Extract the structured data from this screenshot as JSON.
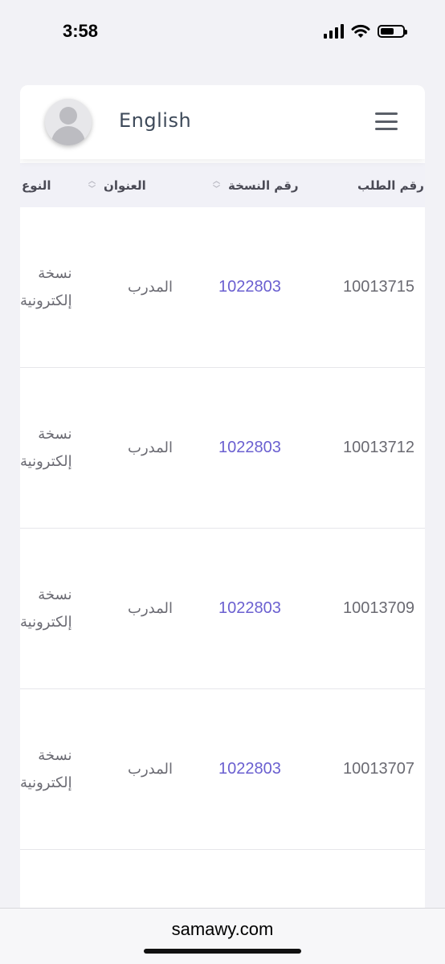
{
  "status_bar": {
    "time": "3:58"
  },
  "header": {
    "language_link": "English",
    "avatar_icon": "user-avatar-icon",
    "menu_icon": "hamburger-menu-icon"
  },
  "table": {
    "columns": {
      "order_number": "رقم الطلب",
      "copy_number": "رقم النسخة",
      "title": "العنوان",
      "type": "النوع"
    },
    "rows": [
      {
        "order_number": "10013715",
        "copy_number": "1022803",
        "title": "المدرب",
        "type_line1": "نسخة",
        "type_line2": "إلكترونية"
      },
      {
        "order_number": "10013712",
        "copy_number": "1022803",
        "title": "المدرب",
        "type_line1": "نسخة",
        "type_line2": "إلكترونية"
      },
      {
        "order_number": "10013709",
        "copy_number": "1022803",
        "title": "المدرب",
        "type_line1": "نسخة",
        "type_line2": "إلكترونية"
      },
      {
        "order_number": "10013707",
        "copy_number": "1022803",
        "title": "المدرب",
        "type_line1": "نسخة",
        "type_line2": "إلكترونية"
      }
    ]
  },
  "browser": {
    "url": "samawy.com"
  },
  "colors": {
    "link": "#6a5fd0",
    "header_bg": "#f1f1f7",
    "text": "#6a6a72"
  }
}
